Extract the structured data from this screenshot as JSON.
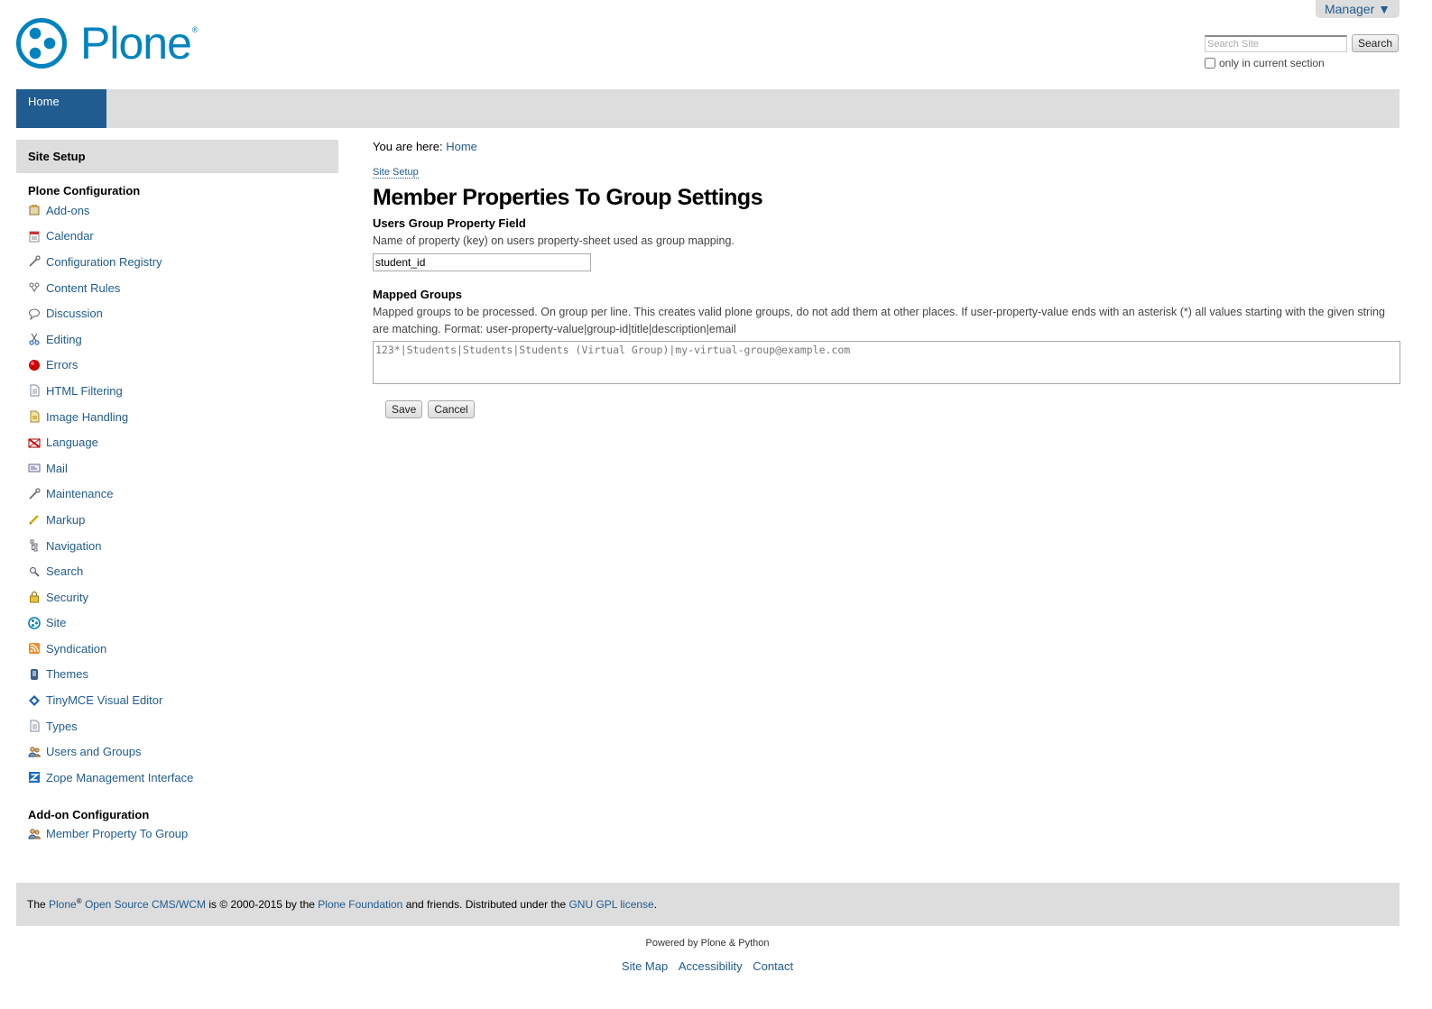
{
  "personal": {
    "label": "Manager ▼"
  },
  "logo": {
    "text": "Plone",
    "reg": "®"
  },
  "search": {
    "placeholder": "Search Site",
    "button": "Search",
    "option": "only in current section"
  },
  "nav": {
    "home": "Home"
  },
  "portlet": {
    "title": "Site Setup",
    "plone_config_title": "Plone Configuration",
    "items": [
      {
        "label": "Add-ons",
        "icon": "addons-icon"
      },
      {
        "label": "Calendar",
        "icon": "calendar-icon"
      },
      {
        "label": "Configuration Registry",
        "icon": "wrench-icon"
      },
      {
        "label": "Content Rules",
        "icon": "content-rules-icon"
      },
      {
        "label": "Discussion",
        "icon": "discussion-icon"
      },
      {
        "label": "Editing",
        "icon": "scissors-icon"
      },
      {
        "label": "Errors",
        "icon": "error-icon"
      },
      {
        "label": "HTML Filtering",
        "icon": "document-icon"
      },
      {
        "label": "Image Handling",
        "icon": "image-icon"
      },
      {
        "label": "Language",
        "icon": "flag-icon"
      },
      {
        "label": "Mail",
        "icon": "mail-icon"
      },
      {
        "label": "Maintenance",
        "icon": "wrench-icon"
      },
      {
        "label": "Markup",
        "icon": "pencil-icon"
      },
      {
        "label": "Navigation",
        "icon": "navigation-icon"
      },
      {
        "label": "Search",
        "icon": "magnifier-icon"
      },
      {
        "label": "Security",
        "icon": "lock-icon"
      },
      {
        "label": "Site",
        "icon": "plone-site-icon"
      },
      {
        "label": "Syndication",
        "icon": "rss-icon"
      },
      {
        "label": "Themes",
        "icon": "themes-icon"
      },
      {
        "label": "TinyMCE Visual Editor",
        "icon": "tinymce-icon"
      },
      {
        "label": "Types",
        "icon": "document-icon"
      },
      {
        "label": "Users and Groups",
        "icon": "users-icon"
      },
      {
        "label": "Zope Management Interface",
        "icon": "zope-icon"
      }
    ],
    "addon_config_title": "Add-on Configuration",
    "addon_items": [
      {
        "label": "Member Property To Group",
        "icon": "users-icon"
      }
    ]
  },
  "content": {
    "breadcrumb_prefix": "You are here:",
    "breadcrumb_home": "Home",
    "setup_link": "Site Setup",
    "title": "Member Properties To Group Settings",
    "field1_label": "Users Group Property Field",
    "field1_help": "Name of property (key) on users property-sheet used as group mapping.",
    "field1_value": "student_id",
    "field2_label": "Mapped Groups",
    "field2_help": "Mapped groups to be processed. On group per line. This creates valid plone groups, do not add them at other places. If user-property-value ends with an asterisk (*) all values starting with the given string are matching. Format: user-property-value|group-id|title|description|email",
    "field2_value": "123*|Students|Students|Students (Virtual Group)|my-virtual-group@example.com",
    "save": "Save",
    "cancel": "Cancel"
  },
  "footer": {
    "t1": "The ",
    "plone": "Plone",
    "reg": "®",
    "cms": "Open Source CMS/WCM",
    "t2": " is © 2000-2015 by the ",
    "foundation": "Plone Foundation",
    "t3": " and friends. Distributed under the ",
    "license": "GNU GPL license",
    "t4": "."
  },
  "colophon": "Powered by Plone & Python",
  "site_actions": [
    "Site Map",
    "Accessibility",
    "Contact"
  ]
}
